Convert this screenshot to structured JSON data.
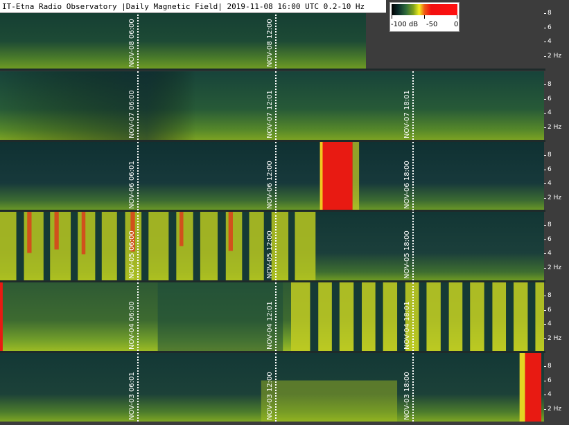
{
  "title": "IT-Etna Radio Observatory |Daily Magnetic Field| 2019-11-08 16:00 UTC 0.2-10 Hz",
  "colorbar": {
    "labels": [
      "-100 dB",
      "-50",
      "0"
    ],
    "colors": [
      "#000000",
      "#0a2a28",
      "#2f6b3b",
      "#7fa11c",
      "#f2ee1e",
      "#f05a14",
      "#ff1010"
    ]
  },
  "y_axis_labels": [
    "8",
    "6",
    "4",
    "2 Hz"
  ],
  "strips": [
    {
      "date": "NOV-08",
      "time_labels": [
        "NOV-08 06:00",
        "NOV-08 12:00"
      ],
      "colored_fraction": 0.67
    },
    {
      "date": "NOV-07",
      "time_labels": [
        "NOV-07 06:00",
        "NOV-07 12:01",
        "NOV-07 18:01"
      ],
      "colored_fraction": 1.0
    },
    {
      "date": "NOV-06",
      "time_labels": [
        "NOV-06 06:01",
        "NOV-06 12:00",
        "NOV-06 18:00"
      ],
      "colored_fraction": 1.0
    },
    {
      "date": "NOV-05",
      "time_labels": [
        "NOV-05 06:00",
        "NOV-05 12:00",
        "NOV-05 18:00"
      ],
      "colored_fraction": 1.0
    },
    {
      "date": "NOV-04",
      "time_labels": [
        "NOV-04 06:00",
        "NOV-04 12:01",
        "NOV-04 18:01"
      ],
      "colored_fraction": 1.0
    },
    {
      "date": "NOV-03",
      "time_labels": [
        "NOV-03 06:01",
        "NOV-03 12:00",
        "NOV-03 18:00"
      ],
      "colored_fraction": 1.0
    }
  ]
}
